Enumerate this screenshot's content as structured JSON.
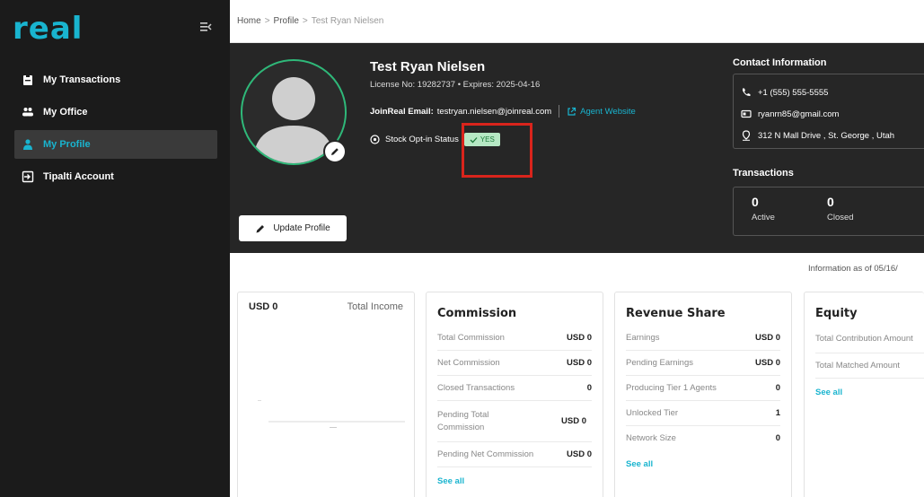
{
  "sidebar": {
    "logo": "real",
    "items": [
      {
        "label": "My Transactions",
        "icon": "clipboard-icon",
        "active": false
      },
      {
        "label": "My Office",
        "icon": "people-icon",
        "active": false
      },
      {
        "label": "My Profile",
        "icon": "person-icon",
        "active": true
      },
      {
        "label": "Tipalti Account",
        "icon": "login-box-icon",
        "active": false
      }
    ]
  },
  "breadcrumb": {
    "home": "Home",
    "profile": "Profile",
    "current": "Test Ryan Nielsen"
  },
  "profile": {
    "name": "Test Ryan Nielsen",
    "license": "License No: 19282737  •  Expires: 2025-04-16",
    "email_label": "JoinReal Email:",
    "email": "testryan.nielsen@joinreal.com",
    "agent_website": "Agent Website",
    "stock_label": "Stock Opt-in Status",
    "stock_value": "YES",
    "update_button": "Update Profile"
  },
  "contact": {
    "title": "Contact Information",
    "phone": "+1 (555) 555-5555",
    "email": "ryanrn85@gmail.com",
    "address": "312 N Mall Drive , St. George , Utah"
  },
  "transactions": {
    "title": "Transactions",
    "active_count": "0",
    "active_label": "Active",
    "closed_count": "0",
    "closed_label": "Closed"
  },
  "info_as_of": "Information as of 05/16/",
  "income": {
    "value": "USD 0",
    "label": "Total Income"
  },
  "commission": {
    "title": "Commission",
    "rows": [
      {
        "label": "Total Commission",
        "value": "USD 0"
      },
      {
        "label": "Net Commission",
        "value": "USD 0"
      },
      {
        "label": "Closed Transactions",
        "value": "0"
      },
      {
        "label": "Pending Total Commission",
        "value": "USD 0"
      },
      {
        "label": "Pending Net Commission",
        "value": "USD 0"
      }
    ],
    "see_all": "See all"
  },
  "revenue": {
    "title": "Revenue Share",
    "rows": [
      {
        "label": "Earnings",
        "value": "USD 0"
      },
      {
        "label": "Pending Earnings",
        "value": "USD 0"
      },
      {
        "label": "Producing Tier 1 Agents",
        "value": "0"
      },
      {
        "label": "Unlocked Tier",
        "value": "1"
      },
      {
        "label": "Network Size",
        "value": "0"
      }
    ],
    "see_all": "See all"
  },
  "equity": {
    "title": "Equity",
    "rows": [
      {
        "label": "Total Contribution Amount",
        "value": ""
      },
      {
        "label": "Total Matched Amount",
        "value": ""
      }
    ],
    "see_all": "See all"
  },
  "colors": {
    "accent": "#19b4cf",
    "success": "#2fb879",
    "highlight": "#d9241c"
  }
}
